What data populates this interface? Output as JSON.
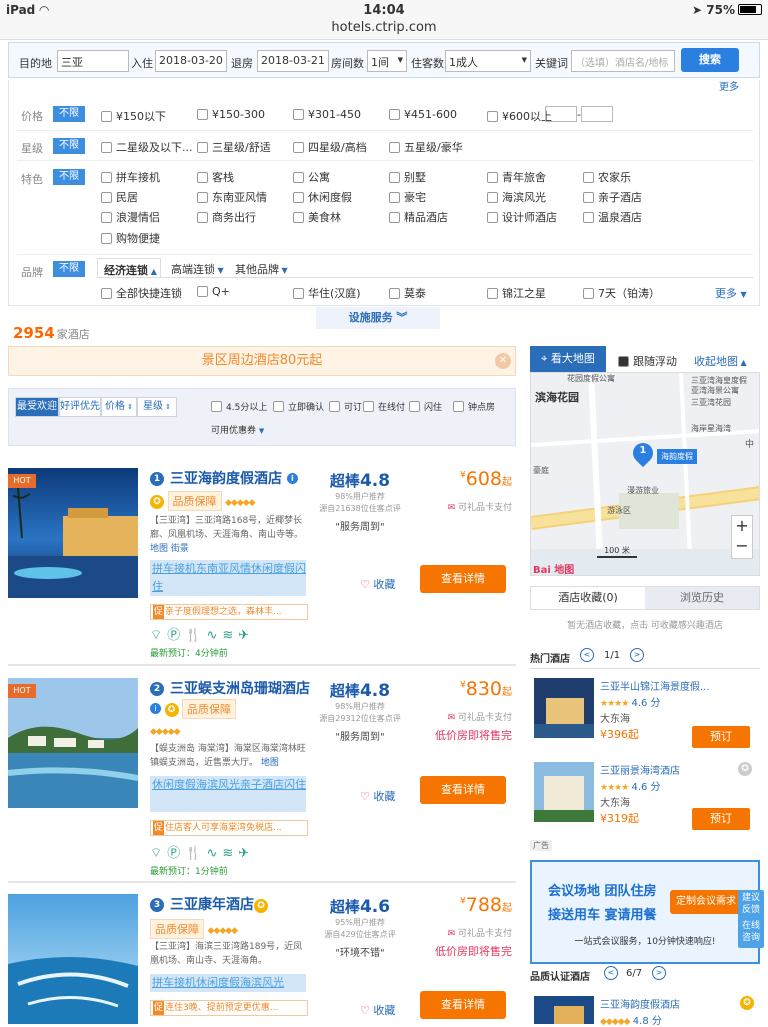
{
  "status": {
    "device": "iPad",
    "time": "14:04",
    "url": "hotels.ctrip.com",
    "battery": "75%"
  },
  "search": {
    "dest_label": "目的地",
    "dest": "三亚",
    "checkin_label": "入住",
    "checkin": "2018-03-20",
    "checkout_label": "退房",
    "checkout": "2018-03-21",
    "rooms_label": "房间数",
    "rooms": "1间",
    "guests_label": "住客数",
    "guests": "1成人",
    "kw_label": "关键词",
    "kw_placeholder": "（选填）酒店名/地标",
    "search_btn": "搜索"
  },
  "filters": {
    "unlimited": "不限",
    "price": {
      "label": "价格",
      "items": [
        "¥150以下",
        "¥150-300",
        "¥301-450",
        "¥451-600",
        "¥600以上"
      ],
      "dash": "-"
    },
    "star": {
      "label": "星级",
      "items": [
        "二星级及以下...",
        "三星级/舒适",
        "四星级/高档",
        "五星级/豪华"
      ]
    },
    "feature": {
      "label": "特色",
      "items": [
        "拼车接机",
        "客栈",
        "公寓",
        "别墅",
        "青年旅舍",
        "农家乐",
        "民居",
        "东南亚风情",
        "休闲度假",
        "豪宅",
        "海滨风光",
        "亲子酒店",
        "浪漫情侣",
        "商务出行",
        "美食林",
        "精品酒店",
        "设计师酒店",
        "温泉酒店",
        "购物便捷"
      ]
    },
    "brand": {
      "label": "品牌",
      "tabs": [
        "经济连锁",
        "高端连锁",
        "其他品牌"
      ],
      "items": [
        "全部快捷连锁",
        "Q+",
        "华住(汉庭)",
        "莫泰",
        "锦江之星",
        "7天（铂涛）"
      ],
      "more": "更多"
    },
    "more_top": "更多"
  },
  "facility_btn": "设施服务",
  "count": {
    "num": "2954",
    "suffix": "家酒店"
  },
  "banner": "景区周边酒店80元起",
  "sort": {
    "tabs": [
      "最受欢迎",
      "好评优先",
      "价格",
      "星级"
    ],
    "checks": [
      "4.5分以上",
      "立即确认",
      "可订",
      "在线付",
      "闪住",
      "钟点房"
    ],
    "coupon": "可用优惠券"
  },
  "hotels": [
    {
      "num": "1",
      "hot": "HOT",
      "name": "三亚海韵度假酒店",
      "badge": "品质保障",
      "addr": "【三亚湾】三亚湾路168号，近椰梦长廊、凤凰机场、天涯海角、南山寺等。",
      "links": "地图 街景",
      "tag": "拼车接机东南亚风情休闲度假闪住",
      "promo": "亲子度假理想之选，森林丰...",
      "promo_icon": "促",
      "recent": "最新预订：",
      "recent_time": "4分钟前",
      "score_lbl": "超棒",
      "score": "4.8",
      "pct": "98%用户推荐",
      "reviews": "源自21638位住客点评",
      "quote": "\"服务周到\"",
      "fav": "收藏",
      "price": "608",
      "price_suffix": "起",
      "currency": "¥",
      "card": "可礼品卡支付",
      "low": "",
      "view": "查看详情"
    },
    {
      "num": "2",
      "hot": "HOT",
      "name": "三亚蜈支洲岛珊瑚酒店",
      "badge": "品质保障",
      "addr": "【蜈支洲岛 海棠湾】海棠区海棠湾林旺镇蜈支洲岛，近售票大厅。",
      "links": "地图",
      "tag": "休闲度假海滨风光亲子酒店闪住",
      "promo": "住店客人可享海棠湾免税店...",
      "promo_icon": "促",
      "recent": "最新预订：",
      "recent_time": "1分钟前",
      "score_lbl": "超棒",
      "score": "4.8",
      "pct": "98%用户推荐",
      "reviews": "源自29312位住客点评",
      "quote": "\"服务周到\"",
      "fav": "收藏",
      "price": "830",
      "price_suffix": "起",
      "currency": "¥",
      "card": "可礼品卡支付",
      "low": "低价房即将售完",
      "view": "查看详情"
    },
    {
      "num": "3",
      "hot": "",
      "name": "三亚康年酒店",
      "badge": "品质保障",
      "addr": "【三亚湾】海滨三亚湾路189号，近凤凰机场、南山寺、天涯海角。",
      "links": "",
      "tag": "拼车接机休闲度假海滨风光",
      "promo": "连住3晚、提前预定更优惠...",
      "promo_icon": "促",
      "recent": "",
      "recent_time": "",
      "score_lbl": "超棒",
      "score": "4.6",
      "pct": "95%用户推荐",
      "reviews": "源自429位住客点评",
      "quote": "\"环境不错\"",
      "fav": "收藏",
      "price": "788",
      "price_suffix": "起",
      "currency": "¥",
      "card": "可礼品卡支付",
      "low": "低价房即将售完",
      "view": "查看详情"
    }
  ],
  "side": {
    "map_big": "看大地图",
    "follow": "跟随浮动",
    "collapse": "收起地图",
    "map_labels": [
      "花园度假公寓",
      "滨海花园",
      "三亚湾花园",
      "海岸星海湾",
      "三亚湾海皇度假",
      "亚湾海景公寓",
      "中",
      "豪庭",
      "豪庭",
      "海韵度假",
      "漫游旅业",
      "游泳区",
      "100 米"
    ],
    "map_pin": "1",
    "map_brand": "Bai 地图",
    "tab_fav": "酒店收藏(0)",
    "tab_hist": "浏览历史",
    "fav_empty": "暂无酒店收藏，点击 可收藏感兴趣酒店",
    "hot_title": "热门酒店",
    "hot_page": "1/1",
    "hot_items": [
      {
        "name": "三亚半山锦江海景度假...",
        "score": "4.6 分",
        "area": "大东海",
        "price": "396",
        "suffix": "起",
        "book": "预订"
      },
      {
        "name": "三亚丽景海湾酒店",
        "score": "4.6 分",
        "area": "大东海",
        "price": "319",
        "suffix": "起",
        "book": "预订"
      }
    ],
    "ad_label": "广告",
    "ad": {
      "l1a": "会议场地",
      "l1b": "团队住房",
      "l2a": "接送用车",
      "l2b": "宴请用餐",
      "btn": "定制会议需求",
      "foot": "一站式会议服务，10分钟快速响应!"
    },
    "cert_title": "品质认证酒店",
    "cert_page": "6/7",
    "cert_item": {
      "name": "三亚海韵度假酒店",
      "score": "4.8 分"
    },
    "float1": "建议反馈",
    "float2": "在线咨询"
  }
}
